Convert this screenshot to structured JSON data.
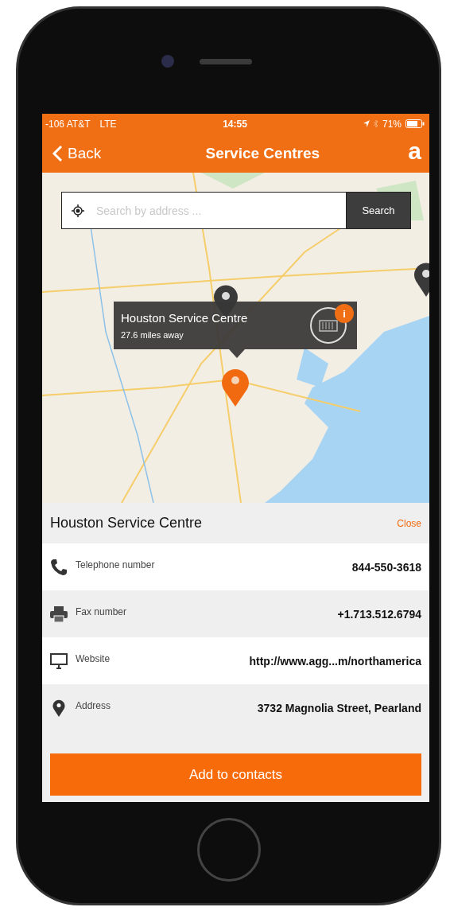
{
  "status_bar": {
    "carrier": "-106 AT&T",
    "network": "LTE",
    "time": "14:55",
    "battery": "71%"
  },
  "nav": {
    "back": "Back",
    "title": "Service Centres",
    "logo": "a"
  },
  "search": {
    "placeholder": "Search by address ...",
    "button": "Search"
  },
  "callout": {
    "title": "Houston Service Centre",
    "distance": "27.6 miles away",
    "badge": "i"
  },
  "details": {
    "title": "Houston Service Centre",
    "close": "Close",
    "rows": [
      {
        "kind": "phone",
        "label": "Telephone number",
        "value": "844-550-3618"
      },
      {
        "kind": "fax",
        "label": "Fax number",
        "value": "+1.713.512.6794"
      },
      {
        "kind": "website",
        "label": "Website",
        "value": "http://www.agg...m/northamerica"
      },
      {
        "kind": "address",
        "label": "Address",
        "value": "3732 Magnolia Street, Pearland"
      }
    ]
  },
  "action": "Add to contacts"
}
